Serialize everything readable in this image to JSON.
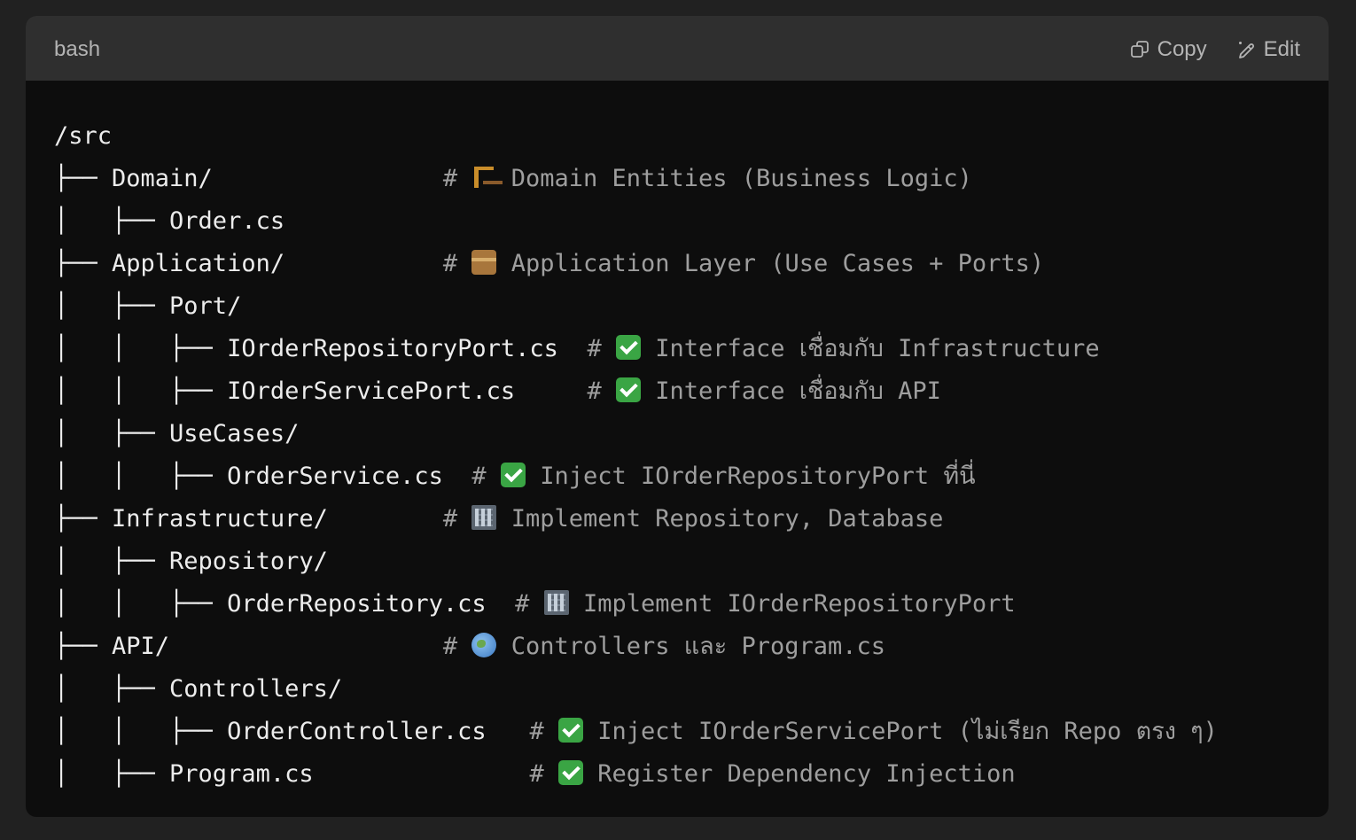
{
  "header": {
    "language": "bash",
    "copy_label": "Copy",
    "edit_label": "Edit"
  },
  "colors": {
    "page_background": "#212121",
    "header_background": "#2f2f2f",
    "code_background": "#0d0d0d",
    "code_text": "#ececec",
    "comment_text": "#9e9e9e"
  },
  "lines": [
    {
      "text": "/src",
      "comment": "",
      "emoji": ""
    },
    {
      "text": "├── Domain/                # ",
      "comment": "Domain Entities (Business Logic)",
      "emoji": "building-construction-icon"
    },
    {
      "text": "│   ├── Order.cs",
      "comment": "",
      "emoji": ""
    },
    {
      "text": "├── Application/           # ",
      "comment": "Application Layer (Use Cases + Ports)",
      "emoji": "package-icon"
    },
    {
      "text": "│   ├── Port/",
      "comment": "",
      "emoji": ""
    },
    {
      "text": "│   │   ├── IOrderRepositoryPort.cs  # ",
      "comment": "Interface เชื่อมกับ Infrastructure",
      "emoji": "check-mark-icon"
    },
    {
      "text": "│   │   ├── IOrderServicePort.cs     # ",
      "comment": "Interface เชื่อมกับ API",
      "emoji": "check-mark-icon"
    },
    {
      "text": "│   ├── UseCases/",
      "comment": "",
      "emoji": ""
    },
    {
      "text": "│   │   ├── OrderService.cs  # ",
      "comment": "Inject IOrderRepositoryPort ที่นี่",
      "emoji": "check-mark-icon"
    },
    {
      "text": "├── Infrastructure/        # ",
      "comment": "Implement Repository, Database",
      "emoji": "office-building-icon"
    },
    {
      "text": "│   ├── Repository/",
      "comment": "",
      "emoji": ""
    },
    {
      "text": "│   │   ├── OrderRepository.cs  # ",
      "comment": "Implement IOrderRepositoryPort",
      "emoji": "office-building-icon"
    },
    {
      "text": "├── API/                   # ",
      "comment": "Controllers และ Program.cs",
      "emoji": "globe-icon"
    },
    {
      "text": "│   ├── Controllers/",
      "comment": "",
      "emoji": ""
    },
    {
      "text": "│   │   ├── OrderController.cs   # ",
      "comment": "Inject IOrderServicePort (ไม่เรียก Repo ตรง ๆ)",
      "emoji": "check-mark-icon"
    },
    {
      "text": "│   ├── Program.cs               # ",
      "comment": "Register Dependency Injection",
      "emoji": "check-mark-icon"
    }
  ]
}
